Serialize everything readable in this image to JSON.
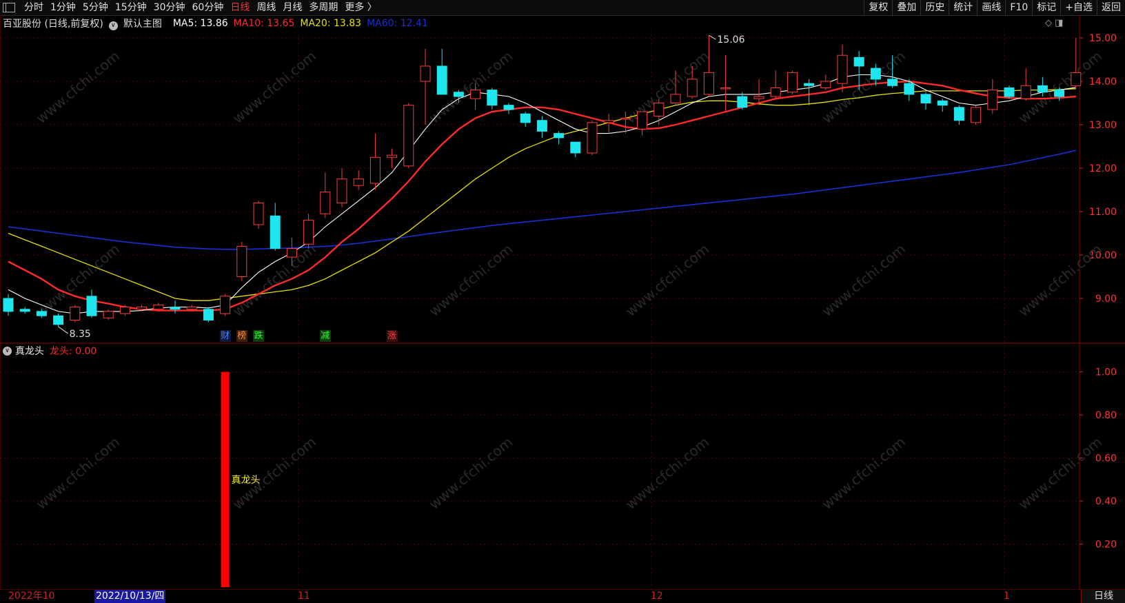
{
  "toolbar": {
    "left": [
      "分时",
      "1分钟",
      "5分钟",
      "15分钟",
      "30分钟",
      "60分钟",
      "日线",
      "周线",
      "月线",
      "多周期",
      "更多 〉"
    ],
    "active": "日线",
    "right": [
      "复权",
      "叠加",
      "历史",
      "统计",
      "画线",
      "F10",
      "标记",
      "+自选",
      "返回"
    ]
  },
  "legend": {
    "stock": "百亚股份 (日线,前复权)",
    "template": "默认主图",
    "ma5_label": "MA5: 13.86",
    "ma10_label": "MA10: 13.65",
    "ma20_label": "MA20: 13.83",
    "ma60_label": "MA60: 12.41",
    "ma5_color": "#ffffff",
    "ma10_color": "#ff2a2a",
    "ma20_color": "#e8e000",
    "ma60_color": "#1a2fd6"
  },
  "sub_legend": {
    "indicator": "真龙头",
    "value_label": "龙头: 0.00"
  },
  "tags": [
    {
      "text": "财",
      "color": "#4a7fff",
      "bg": "#0d1a3d"
    },
    {
      "text": "榜",
      "color": "#ff8a2a",
      "bg": "#3d1f0d"
    },
    {
      "text": "跌",
      "color": "#22ff22",
      "bg": "#0d3d0d"
    },
    {
      "text": "减",
      "color": "#22ff22",
      "bg": "#0d3d0d"
    },
    {
      "text": "涨",
      "color": "#ff4444",
      "bg": "#3d0d0d"
    }
  ],
  "dates": {
    "start": "2022年10",
    "cursor": "2022/10/13/四",
    "m11": "11",
    "m12": "12",
    "m1": "1"
  },
  "period_label": "日线",
  "watermark": "www.cfchi.com",
  "chart_data": {
    "type": "candlestick",
    "main": {
      "ylim": [
        8.2,
        15.3
      ],
      "yticks": [
        "15.00",
        "14.00",
        "13.00",
        "12.00",
        "11.00",
        "10.00",
        "9.00"
      ],
      "high_label": "15.06",
      "low_label": "8.35",
      "candles": [
        [
          9.0,
          8.7,
          9.1,
          8.6
        ],
        [
          8.75,
          8.7,
          8.8,
          8.65
        ],
        [
          8.7,
          8.6,
          8.75,
          8.55
        ],
        [
          8.6,
          8.4,
          8.65,
          8.35
        ],
        [
          8.5,
          8.8,
          8.85,
          8.45
        ],
        [
          9.05,
          8.6,
          9.2,
          8.55
        ],
        [
          8.55,
          8.7,
          8.75,
          8.5
        ],
        [
          8.65,
          8.8,
          8.85,
          8.6
        ],
        [
          8.75,
          8.8,
          8.85,
          8.7
        ],
        [
          8.75,
          8.85,
          8.9,
          8.7
        ],
        [
          8.8,
          8.75,
          8.95,
          8.65
        ],
        [
          8.75,
          8.8,
          8.85,
          8.7
        ],
        [
          8.75,
          8.5,
          8.8,
          8.45
        ],
        [
          8.65,
          9.05,
          9.1,
          8.6
        ],
        [
          9.5,
          10.2,
          10.3,
          9.4
        ],
        [
          10.7,
          11.2,
          11.25,
          10.6
        ],
        [
          10.9,
          10.15,
          11.2,
          10.1
        ],
        [
          9.95,
          10.15,
          10.4,
          9.75
        ],
        [
          10.25,
          10.8,
          10.95,
          10.15
        ],
        [
          10.95,
          11.45,
          11.9,
          10.85
        ],
        [
          11.2,
          11.75,
          12.0,
          11.1
        ],
        [
          11.6,
          11.75,
          11.95,
          11.5
        ],
        [
          11.65,
          12.25,
          12.8,
          11.5
        ],
        [
          12.25,
          12.3,
          12.45,
          12.0
        ],
        [
          12.05,
          13.45,
          13.5,
          12.0
        ],
        [
          14.0,
          14.35,
          14.75,
          13.0
        ],
        [
          14.35,
          13.7,
          14.75,
          13.7
        ],
        [
          13.75,
          13.65,
          13.8,
          13.5
        ],
        [
          13.6,
          13.8,
          13.95,
          13.35
        ],
        [
          13.8,
          13.45,
          13.85,
          13.35
        ],
        [
          13.45,
          13.35,
          13.5,
          13.25
        ],
        [
          13.25,
          13.05,
          13.3,
          12.95
        ],
        [
          13.1,
          12.85,
          13.2,
          12.7
        ],
        [
          12.8,
          12.7,
          12.85,
          12.55
        ],
        [
          12.6,
          12.35,
          12.6,
          12.25
        ],
        [
          12.35,
          13.05,
          13.1,
          12.3
        ],
        [
          13.05,
          13.1,
          13.25,
          12.8
        ],
        [
          13.15,
          13.15,
          13.3,
          12.8
        ],
        [
          12.9,
          13.3,
          13.3,
          12.75
        ],
        [
          13.2,
          13.5,
          13.6,
          13.0
        ],
        [
          13.5,
          13.7,
          14.25,
          13.45
        ],
        [
          13.65,
          14.05,
          14.35,
          13.6
        ],
        [
          13.7,
          14.2,
          15.06,
          13.65
        ],
        [
          13.85,
          13.85,
          14.6,
          13.3
        ],
        [
          13.65,
          13.4,
          13.75,
          13.35
        ],
        [
          13.6,
          13.65,
          14.05,
          13.45
        ],
        [
          13.65,
          13.85,
          14.25,
          13.6
        ],
        [
          13.75,
          14.2,
          14.25,
          13.7
        ],
        [
          13.95,
          13.9,
          14.05,
          13.45
        ],
        [
          13.85,
          14.0,
          14.15,
          13.8
        ],
        [
          13.95,
          14.6,
          14.85,
          13.75
        ],
        [
          14.55,
          14.35,
          14.7,
          13.8
        ],
        [
          14.3,
          14.05,
          14.4,
          13.9
        ],
        [
          14.05,
          13.9,
          14.6,
          13.85
        ],
        [
          13.95,
          13.7,
          14.05,
          13.55
        ],
        [
          13.7,
          13.5,
          13.75,
          13.35
        ],
        [
          13.55,
          13.45,
          13.6,
          13.3
        ],
        [
          13.4,
          13.1,
          13.45,
          13.0
        ],
        [
          13.05,
          13.4,
          13.45,
          13.0
        ],
        [
          13.35,
          13.8,
          14.05,
          13.25
        ],
        [
          13.85,
          13.65,
          13.9,
          13.6
        ],
        [
          13.6,
          13.9,
          14.3,
          13.55
        ],
        [
          13.9,
          13.75,
          14.1,
          13.65
        ],
        [
          13.8,
          13.65,
          13.85,
          13.55
        ],
        [
          13.9,
          14.2,
          15.0,
          13.85
        ]
      ],
      "ma5": [
        9.2,
        9.0,
        8.85,
        8.7,
        8.65,
        8.7,
        8.7,
        8.7,
        8.72,
        8.78,
        8.8,
        8.8,
        8.78,
        8.85,
        9.25,
        9.6,
        9.85,
        10.05,
        10.3,
        10.65,
        10.95,
        11.25,
        11.55,
        11.9,
        12.4,
        12.9,
        13.35,
        13.6,
        13.75,
        13.7,
        13.65,
        13.5,
        13.3,
        13.1,
        12.9,
        12.8,
        12.8,
        12.85,
        12.95,
        13.1,
        13.3,
        13.5,
        13.65,
        13.7,
        13.7,
        13.7,
        13.75,
        13.8,
        13.85,
        13.95,
        14.1,
        14.15,
        14.15,
        14.1,
        14.0,
        13.8,
        13.65,
        13.5,
        13.45,
        13.5,
        13.55,
        13.65,
        13.75,
        13.8,
        13.86
      ],
      "ma10": [
        9.85,
        9.65,
        9.45,
        9.2,
        9.05,
        8.95,
        8.88,
        8.8,
        8.75,
        8.72,
        8.72,
        8.72,
        8.72,
        8.75,
        8.9,
        9.1,
        9.3,
        9.45,
        9.65,
        9.95,
        10.3,
        10.6,
        10.95,
        11.3,
        11.7,
        12.15,
        12.55,
        12.9,
        13.15,
        13.3,
        13.35,
        13.4,
        13.4,
        13.35,
        13.25,
        13.15,
        13.05,
        12.95,
        12.9,
        12.92,
        13.0,
        13.1,
        13.2,
        13.3,
        13.4,
        13.5,
        13.6,
        13.65,
        13.7,
        13.75,
        13.85,
        13.9,
        13.95,
        13.98,
        14.0,
        13.95,
        13.9,
        13.8,
        13.72,
        13.65,
        13.62,
        13.6,
        13.6,
        13.62,
        13.65
      ],
      "ma20": [
        10.5,
        10.35,
        10.2,
        10.05,
        9.9,
        9.75,
        9.6,
        9.45,
        9.3,
        9.15,
        9.0,
        8.95,
        8.95,
        9.0,
        9.05,
        9.1,
        9.15,
        9.2,
        9.3,
        9.45,
        9.65,
        9.85,
        10.05,
        10.3,
        10.55,
        10.85,
        11.15,
        11.45,
        11.75,
        12.0,
        12.25,
        12.45,
        12.6,
        12.75,
        12.85,
        12.95,
        13.05,
        13.15,
        13.25,
        13.35,
        13.45,
        13.52,
        13.55,
        13.55,
        13.52,
        13.48,
        13.45,
        13.45,
        13.48,
        13.52,
        13.58,
        13.62,
        13.68,
        13.72,
        13.75,
        13.78,
        13.78,
        13.78,
        13.78,
        13.78,
        13.78,
        13.8,
        13.8,
        13.81,
        13.83
      ],
      "ma60": [
        10.65,
        10.6,
        10.55,
        10.5,
        10.45,
        10.4,
        10.35,
        10.3,
        10.26,
        10.22,
        10.18,
        10.16,
        10.14,
        10.13,
        10.13,
        10.14,
        10.15,
        10.16,
        10.18,
        10.2,
        10.23,
        10.27,
        10.32,
        10.37,
        10.42,
        10.48,
        10.53,
        10.58,
        10.63,
        10.68,
        10.72,
        10.76,
        10.8,
        10.84,
        10.88,
        10.92,
        10.96,
        11.0,
        11.04,
        11.08,
        11.12,
        11.16,
        11.2,
        11.24,
        11.28,
        11.32,
        11.36,
        11.4,
        11.45,
        11.5,
        11.55,
        11.6,
        11.65,
        11.7,
        11.75,
        11.8,
        11.85,
        11.9,
        11.96,
        12.02,
        12.08,
        12.16,
        12.24,
        12.32,
        12.41
      ]
    },
    "sub": {
      "ylim": [
        0,
        1.05
      ],
      "yticks": [
        "1.00",
        "0.80",
        "0.60",
        "0.40",
        "0.20"
      ],
      "bar_index": 13,
      "bar_value": 1.0,
      "bar_label": "真龙头",
      "bar_color": "#ff0000"
    },
    "tag_indices": [
      13,
      14,
      15,
      19,
      23
    ],
    "up_color": "#ff3b3b",
    "down_color": "#1ee6ee"
  }
}
